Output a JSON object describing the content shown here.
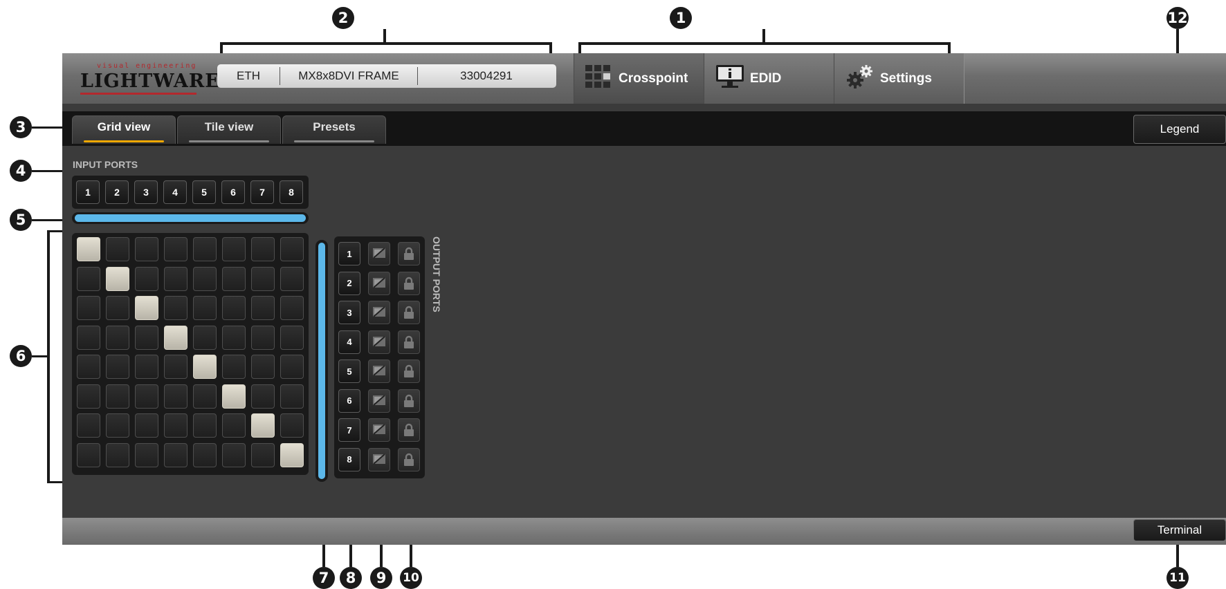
{
  "callouts": {
    "c1": "1",
    "c2": "2",
    "c3": "3",
    "c4": "4",
    "c5": "5",
    "c6": "6",
    "c7": "7",
    "c8": "8",
    "c9": "9",
    "c10": "10",
    "c11": "11",
    "c12": "12"
  },
  "logo": {
    "tagline": "visual engineering",
    "name": "LIGHTWARE"
  },
  "device_info": {
    "connection": "ETH",
    "model": "MX8x8DVI FRAME",
    "serial": "33004291"
  },
  "nav_tabs": [
    {
      "label": "Crosspoint",
      "icon": "grid-icon",
      "active": true
    },
    {
      "label": "EDID",
      "icon": "monitor-info-icon",
      "active": false
    },
    {
      "label": "Settings",
      "icon": "gears-icon",
      "active": false
    }
  ],
  "sub_tabs": [
    {
      "label": "Grid view",
      "active": true
    },
    {
      "label": "Tile view",
      "active": false
    },
    {
      "label": "Presets",
      "active": false
    }
  ],
  "legend_label": "Legend",
  "input_ports_label": "INPUT PORTS",
  "input_ports": [
    "1",
    "2",
    "3",
    "4",
    "5",
    "6",
    "7",
    "8"
  ],
  "output_ports_label": "OUTPUT PORTS",
  "output_ports": [
    "1",
    "2",
    "3",
    "4",
    "5",
    "6",
    "7",
    "8"
  ],
  "crosspoint_connections": [
    1,
    2,
    3,
    4,
    5,
    6,
    7,
    8
  ],
  "terminal_label": "Terminal",
  "colors": {
    "accent_blue": "#5cb8ea",
    "active_tab_underline": "#f0a800",
    "connected_cell": "#d6d2c5",
    "logo_red": "#b3282d"
  }
}
